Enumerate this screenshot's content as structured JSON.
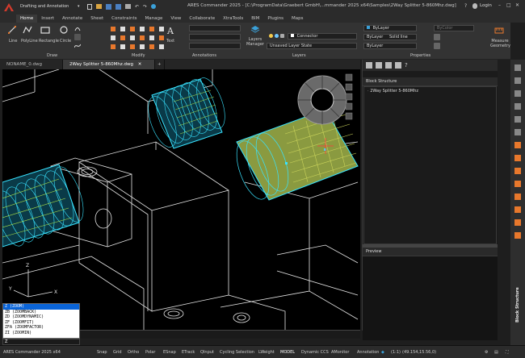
{
  "app": {
    "title": "ARES Commander 2025 - [C:\\ProgramData\\Graebert GmbH\\...mmander 2025 x64\\Samples\\2Way Splitter 5-860Mhz.dwg]",
    "workspace": "Drafting and Annotation",
    "login_label": "Login",
    "version": "ARES Commander 2025 x64"
  },
  "ribbon": {
    "tabs": [
      "Home",
      "Insert",
      "Annotate",
      "Sheet",
      "Constraints",
      "Manage",
      "View",
      "Collaborate",
      "XtraTools",
      "BIM",
      "Plugins",
      "Maps"
    ],
    "draw_tools": [
      "Line",
      "PolyLine",
      "Rectangle",
      "Circle"
    ],
    "text_tool": "Text",
    "layers_manager_label": "Layers Manager",
    "layer_current": "Connector",
    "layer_state": "Unsaved Layer State",
    "color_value": "ByLayer",
    "linetype_value": "ByLayer",
    "linetype_style": "Solid line",
    "lineweight_value": "ByLayer",
    "plot_style": "ByColor",
    "measure_label": "Measure Geometry",
    "panels": [
      "Draw",
      "Modify",
      "Annotations",
      "Layers",
      "Properties"
    ]
  },
  "documents": {
    "tabs": [
      "NONAME_0.dwg",
      "2Way Splitter 5-860Mhz.dwg"
    ],
    "add_label": "+"
  },
  "side_panel": {
    "block_structure_title": "Block Structure",
    "tree_item": "2Way Splitter 5-860Mhz",
    "preview_title": "Preview",
    "vertical_label": "Block Structure"
  },
  "command_list": {
    "items": [
      "Z (ZOOM)",
      "ZB (ZOOMBACK)",
      "ZD (ZOOMDYNAMIC)",
      "ZF (ZOOMFIT)",
      "ZFA (ZOOMFACTOR)",
      "ZI (ZOOMIN)"
    ],
    "selected_index": 0
  },
  "command_line": {
    "value": "Z"
  },
  "ucs": {
    "x_label": "X",
    "y_label": "Y",
    "z_label": "Z"
  },
  "status_bar": {
    "items": [
      "Snap",
      "Grid",
      "Ortho",
      "Polar",
      "ESnap",
      "ETrack",
      "QInput",
      "Cycling Selection",
      "LWeight",
      "MODEL",
      "Dynamic CCS",
      "AMonitor",
      "Annotation"
    ],
    "scale": "(1:1)",
    "coords": "(49.154,15.56,0)"
  },
  "colors": {
    "accent": "#0a64d8",
    "cylinder_cyan": "#39e3ff",
    "cylinder_green": "#b0e84a",
    "cylinder_selected": "#9aa84a",
    "wire": "#e6e6e6"
  }
}
